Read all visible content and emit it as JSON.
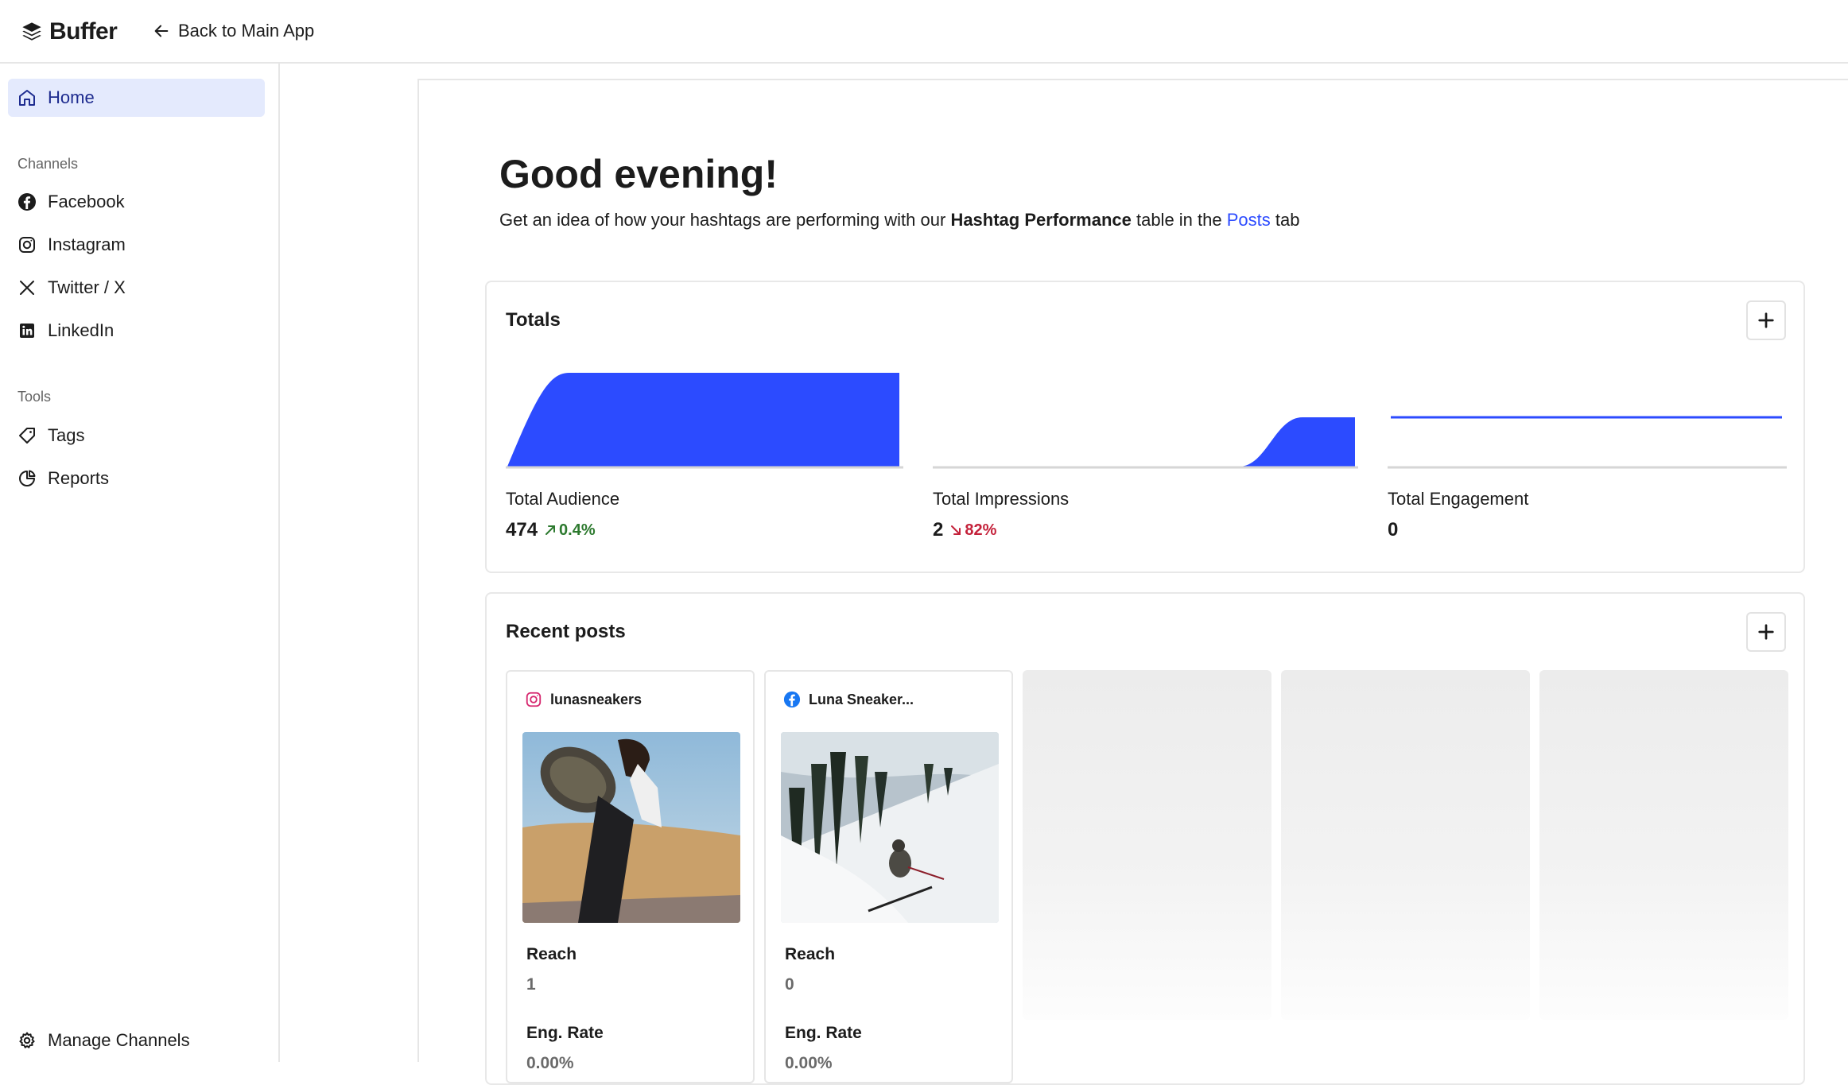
{
  "app": {
    "brand": "Buffer",
    "back_link": "Back to Main App"
  },
  "sidebar": {
    "home": "Home",
    "channels_heading": "Channels",
    "channels": [
      "Facebook",
      "Instagram",
      "Twitter / X",
      "LinkedIn"
    ],
    "tools_heading": "Tools",
    "tools": [
      "Tags",
      "Reports"
    ],
    "manage": "Manage Channels"
  },
  "main": {
    "greeting": "Good evening!",
    "subtitle": {
      "part1": "Get an idea of how your hashtags are performing with our ",
      "bold": "Hashtag Performance",
      "part2": " table in the ",
      "link": "Posts",
      "part3": " tab"
    }
  },
  "totals": {
    "title": "Totals",
    "metrics": [
      {
        "label": "Total Audience",
        "value": "474",
        "delta": "0.4%",
        "direction": "up"
      },
      {
        "label": "Total Impressions",
        "value": "2",
        "delta": "82%",
        "direction": "down"
      },
      {
        "label": "Total Engagement",
        "value": "0",
        "delta": "",
        "direction": "none"
      }
    ]
  },
  "recent_posts": {
    "title": "Recent posts",
    "posts": [
      {
        "account": "lunasneakers",
        "network": "instagram",
        "reach_label": "Reach",
        "reach": "1",
        "eng_label": "Eng. Rate",
        "eng": "0.00%"
      },
      {
        "account": "Luna Sneaker...",
        "network": "facebook",
        "reach_label": "Reach",
        "reach": "0",
        "eng_label": "Eng. Rate",
        "eng": "0.00%"
      }
    ]
  },
  "colors": {
    "accent": "#2c4bff",
    "active_bg": "#e4eafd",
    "up": "#2d7a2f",
    "down": "#c4213a"
  }
}
